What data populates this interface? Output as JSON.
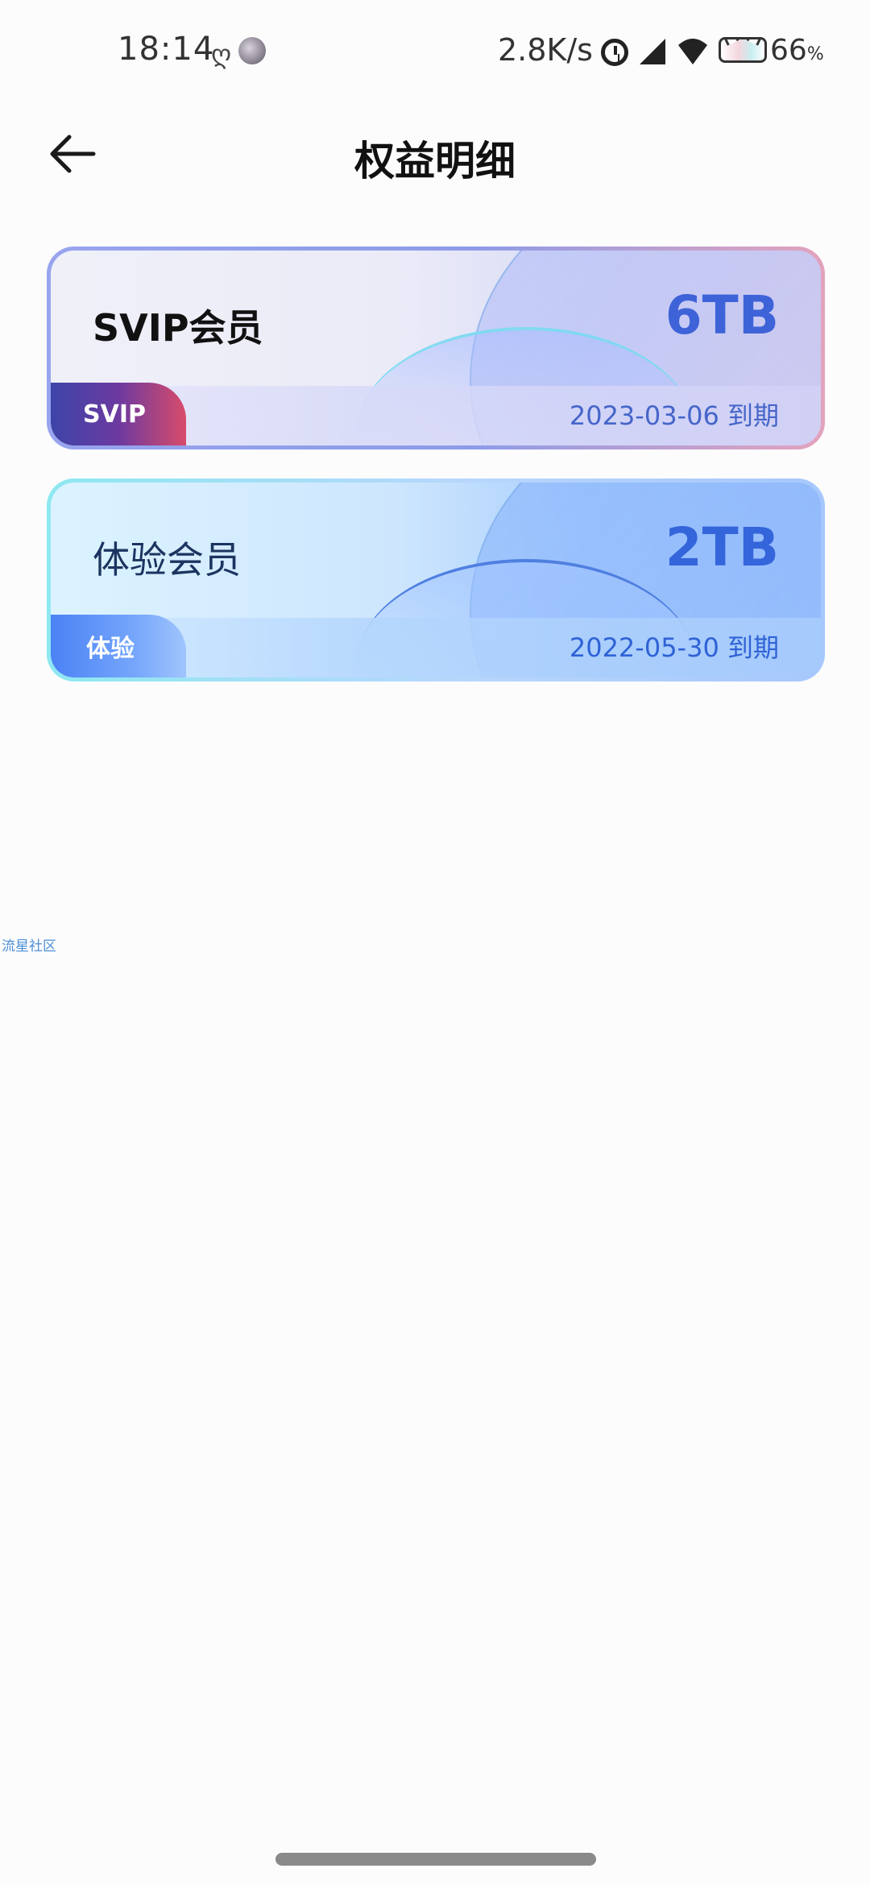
{
  "status_bar": {
    "time": "18:14",
    "time_glyph": "ღ",
    "net_speed": "2.8K/s",
    "battery_level": "66",
    "battery_unit": "%",
    "icons": [
      "avatar-icon",
      "alarm-icon",
      "signal-icon",
      "wifi-icon",
      "battery-icon"
    ]
  },
  "header": {
    "title": "权益明细",
    "back_icon": "arrow-left-icon"
  },
  "cards": [
    {
      "name": "SVIP会员",
      "size": "6TB",
      "tag": "SVIP",
      "expiry": "2023-03-06 到期",
      "accent": "#3e63d8"
    },
    {
      "name": "体验会员",
      "size": "2TB",
      "tag": "体验",
      "expiry": "2022-05-30 到期",
      "accent": "#3465db"
    }
  ],
  "watermark": "流星社区"
}
